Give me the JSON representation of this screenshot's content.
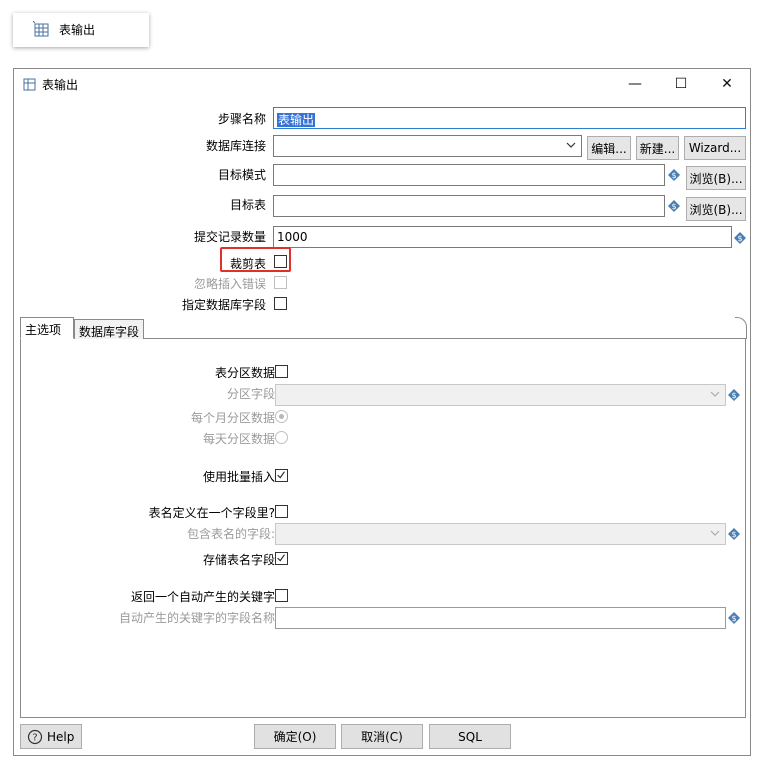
{
  "step_node": {
    "label": "表输出",
    "icon": "table-output-icon"
  },
  "window": {
    "title": "表输出",
    "controls": {
      "minimize": "—",
      "maximize": "☐",
      "close": "✕"
    }
  },
  "form": {
    "step_name_label": "步骤名称",
    "step_name_value": "表输出",
    "connection_label": "数据库连接",
    "connection_value": "",
    "edit_button": "编辑...",
    "new_button": "新建...",
    "wizard_button": "Wizard...",
    "target_schema_label": "目标模式",
    "target_schema_value": "",
    "browse_schema_button": "浏览(B)...",
    "target_table_label": "目标表",
    "target_table_value": "",
    "browse_table_button": "浏览(B)...",
    "commit_size_label": "提交记录数量",
    "commit_size_value": "1000",
    "truncate_label": "裁剪表",
    "truncate_checked": false,
    "ignore_errors_label": "忽略插入错误",
    "ignore_errors_checked": false,
    "specify_fields_label": "指定数据库字段",
    "specify_fields_checked": false
  },
  "tabs": [
    {
      "label": "主选项",
      "active": true
    },
    {
      "label": "数据库字段",
      "active": false
    }
  ],
  "main_options": {
    "partition_label": "表分区数据",
    "partition_checked": false,
    "partition_field_label": "分区字段",
    "partition_field_value": "",
    "monthly_label": "每个月分区数据",
    "monthly_selected": true,
    "daily_label": "每天分区数据",
    "daily_selected": false,
    "batch_label": "使用批量插入",
    "batch_checked": true,
    "table_in_field_label": "表名定义在一个字段里?",
    "table_in_field_checked": false,
    "table_name_field_label": "包含表名的字段:",
    "table_name_field_value": "",
    "store_table_name_label": "存储表名字段",
    "store_table_name_checked": true,
    "return_key_label": "返回一个自动产生的关键字",
    "return_key_checked": false,
    "key_field_name_label": "自动产生的关键字的字段名称",
    "key_field_name_value": ""
  },
  "bottom": {
    "help_button": "Help",
    "ok_button": "确定(O)",
    "cancel_button": "取消(C)",
    "sql_button": "SQL"
  },
  "colors": {
    "highlight": "#e0302a",
    "selection": "#3572d6",
    "variable_icon": "#4a7fb5"
  }
}
